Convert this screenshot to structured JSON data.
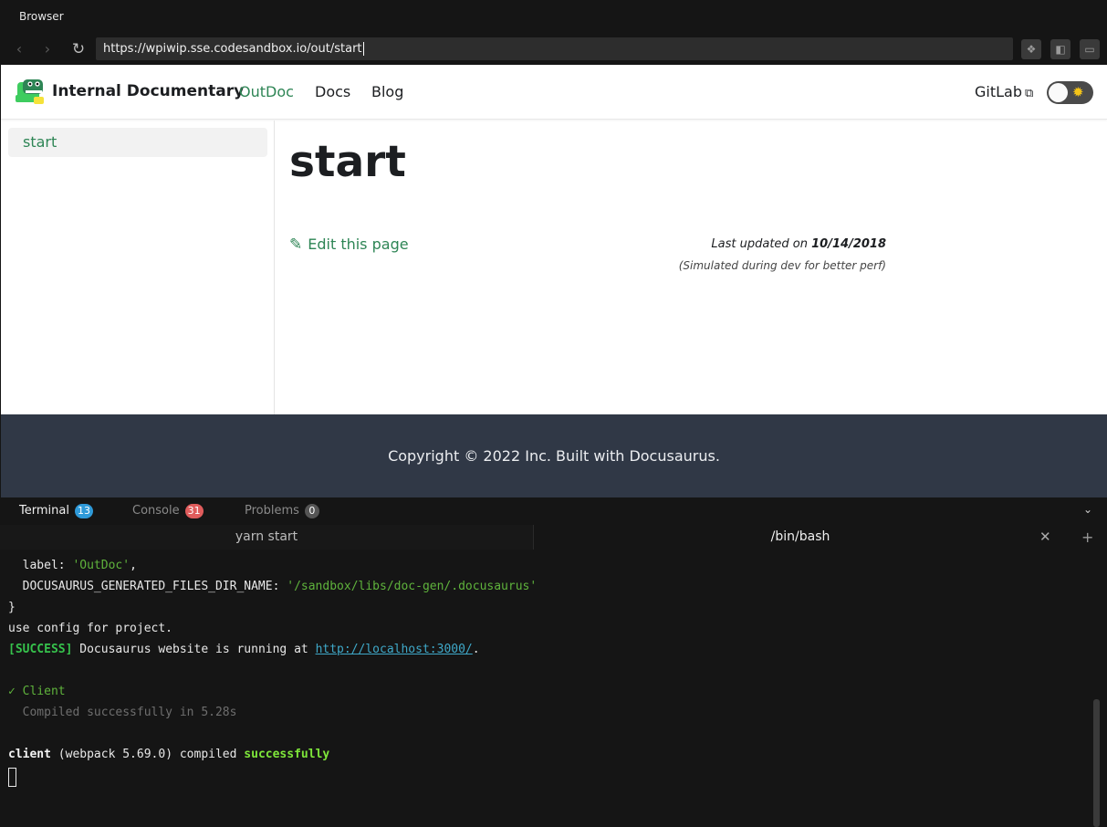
{
  "chrome": {
    "title": "Browser",
    "url": "https://wpiwip.sse.codesandbox.io/out/start",
    "back_glyph": "‹",
    "forward_glyph": "›",
    "reload_glyph": "↻"
  },
  "site": {
    "brand": "Internal Documentary",
    "nav": [
      {
        "label": "OutDoc",
        "active": true
      },
      {
        "label": "Docs",
        "active": false
      },
      {
        "label": "Blog",
        "active": false
      }
    ],
    "gitlab_label": "GitLab",
    "sidebar": {
      "items": [
        {
          "label": "start",
          "active": true
        }
      ]
    },
    "page_title": "start",
    "edit_link": "Edit this page",
    "last_updated_prefix": "Last updated on ",
    "last_updated_date": "10/14/2018",
    "last_updated_note": "(Simulated during dev for better perf)",
    "footer": "Copyright © 2022 Inc. Built with Docusaurus.",
    "colors": {
      "accent": "#2e8555",
      "footer_bg": "#303846"
    }
  },
  "panel": {
    "tabs": [
      {
        "label": "Terminal",
        "badge": "13",
        "active": true
      },
      {
        "label": "Console",
        "badge": "31",
        "active": false
      },
      {
        "label": "Problems",
        "badge": "0",
        "active": false
      }
    ],
    "terminal_tabs": [
      {
        "label": "yarn start"
      },
      {
        "label": "/bin/bash"
      }
    ]
  },
  "terminal": {
    "line1_key": "  label: ",
    "line1_val": "'OutDoc'",
    "line1_end": ",",
    "line2_key": "  DOCUSAURUS_GENERATED_FILES_DIR_NAME: ",
    "line2_val": "'/sandbox/libs/doc-gen/.docusaurus'",
    "line3": "}",
    "line4": "use config for project.",
    "line5_tag": "[SUCCESS]",
    "line5_text": " Docusaurus website is running at ",
    "line5_link": "http://localhost:3000/",
    "line5_end": ".",
    "line6": "✓ Client",
    "line7": "  Compiled successfully in 5.28s",
    "line8_a": "client",
    "line8_b": " (webpack 5.69.0) compiled ",
    "line8_c": "successfully"
  }
}
